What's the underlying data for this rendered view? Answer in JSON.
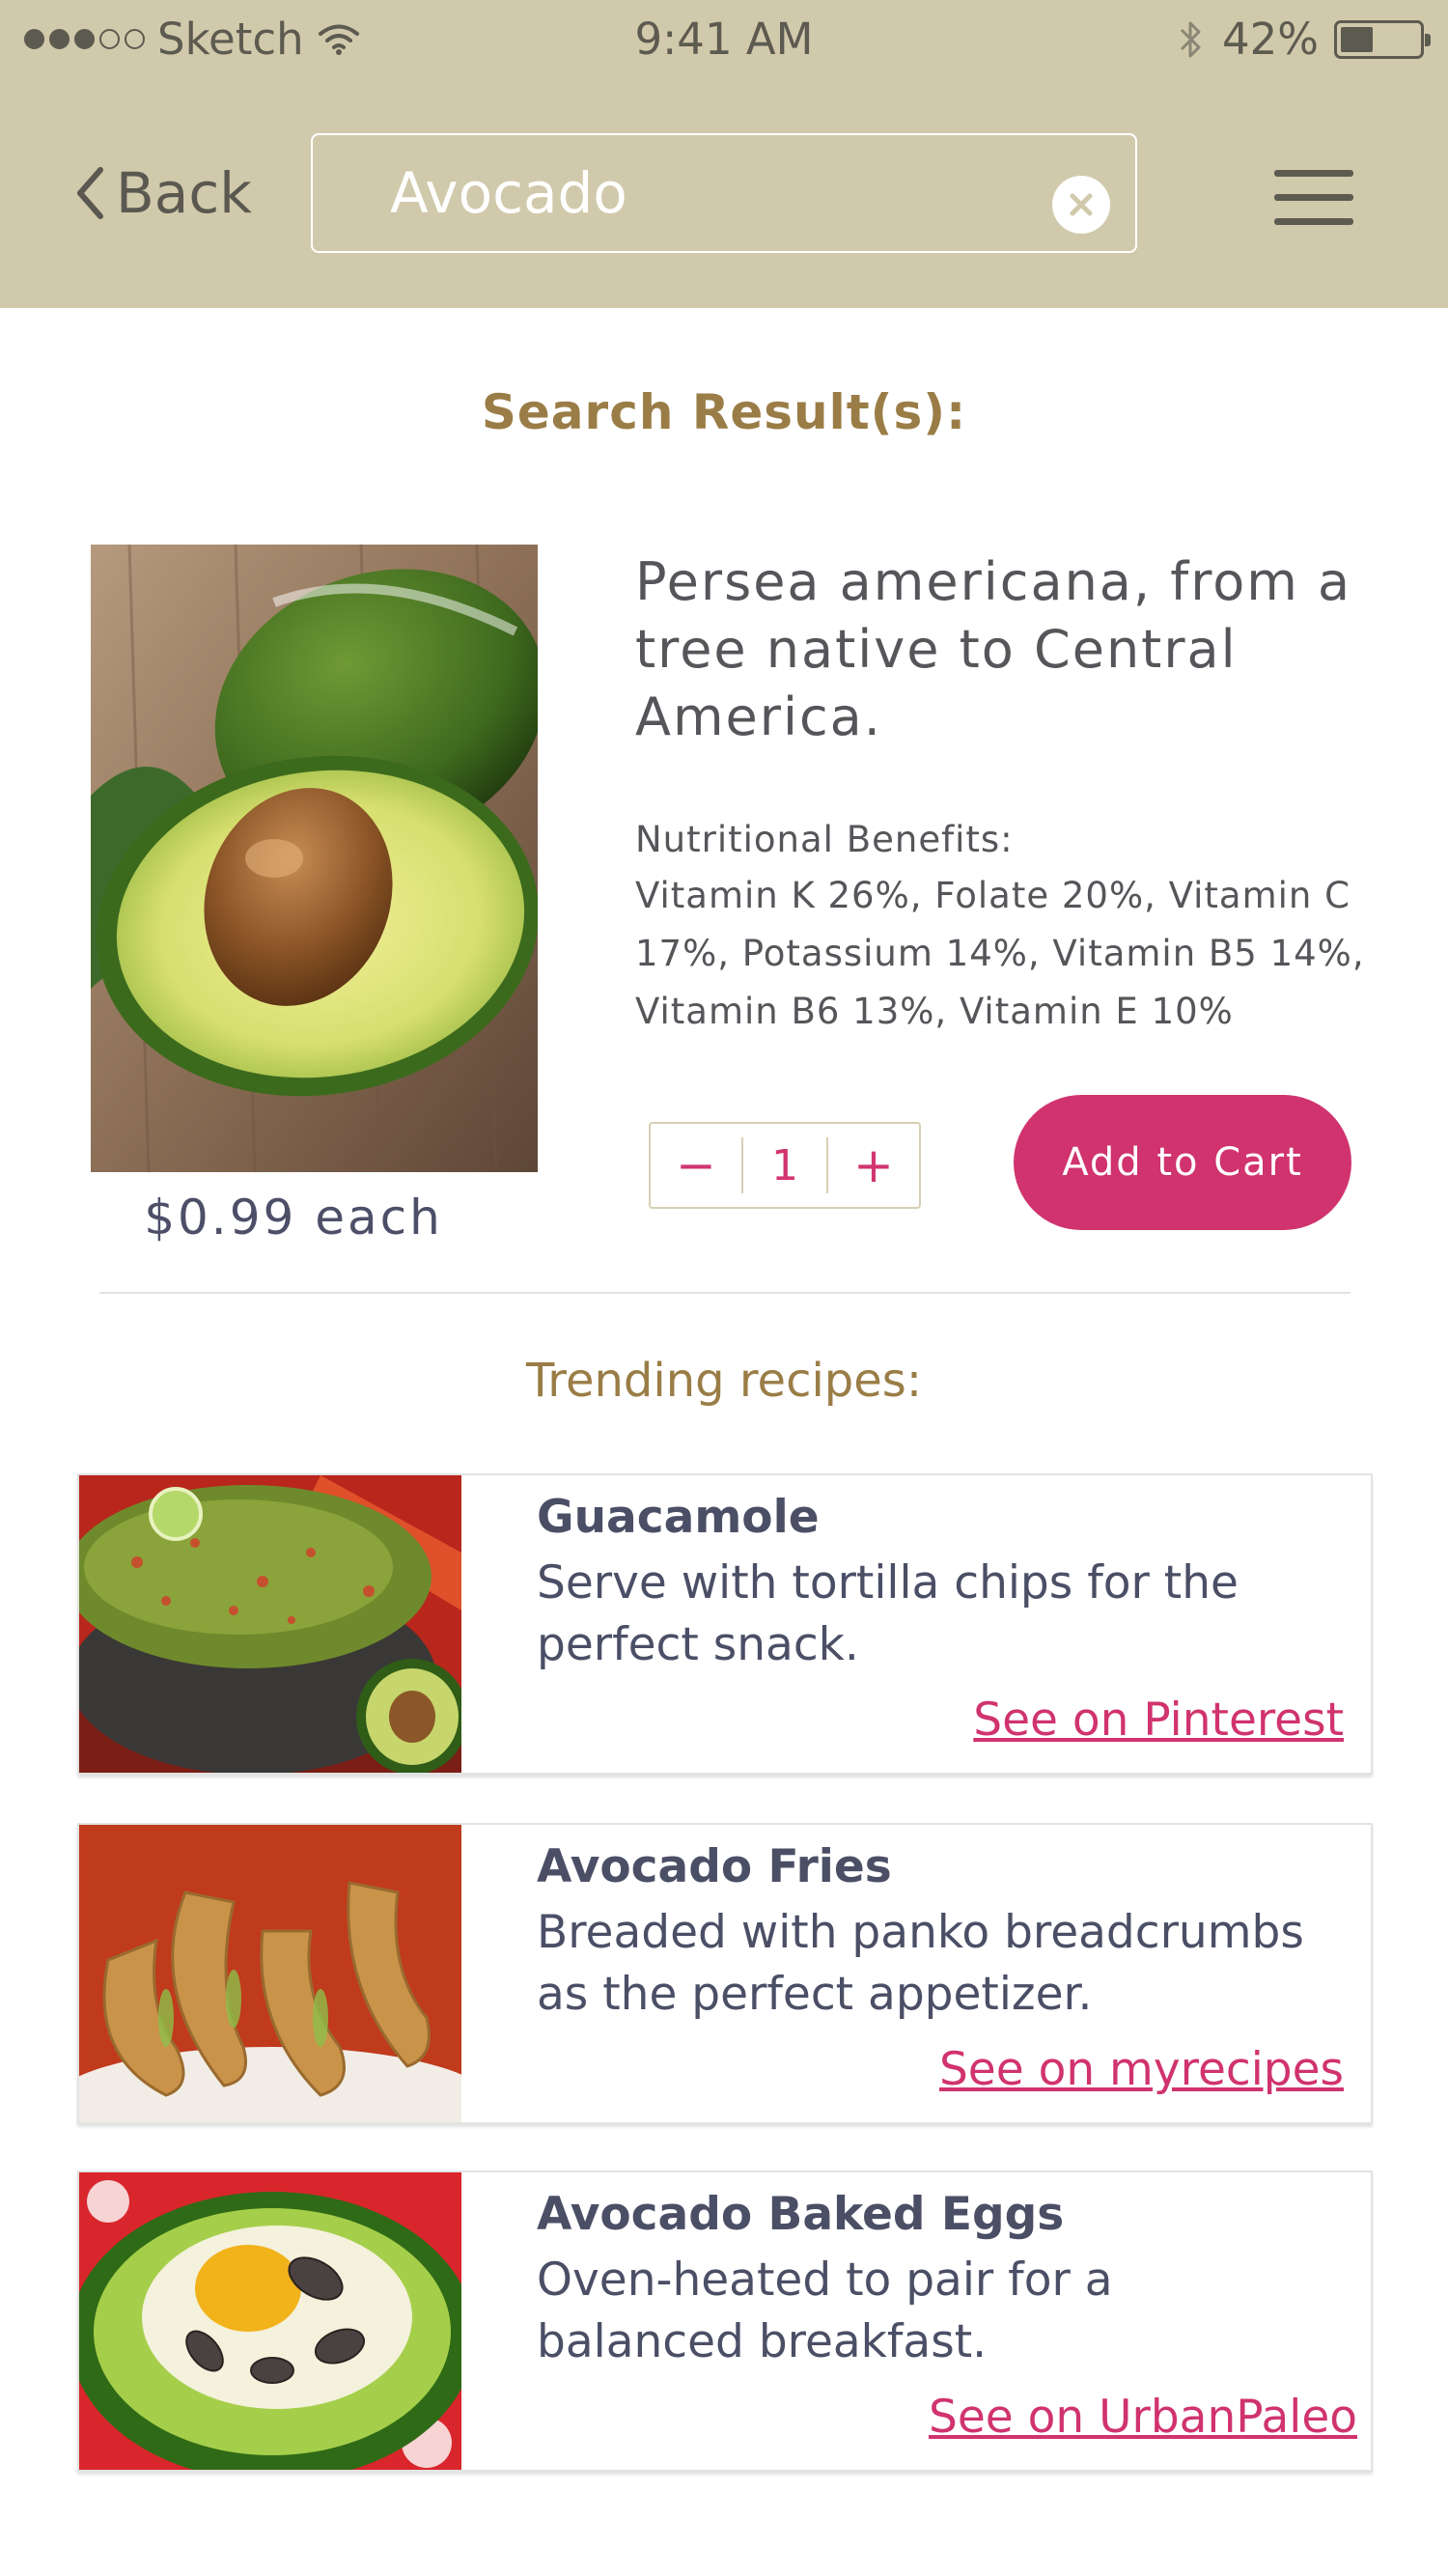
{
  "status_bar": {
    "carrier": "Sketch",
    "time": "9:41 AM",
    "battery": "42%",
    "battery_level": 0.42,
    "signal_bars_filled": 3,
    "signal_bars_total": 5,
    "icons": [
      "wifi-icon",
      "bluetooth-icon",
      "battery-icon"
    ]
  },
  "nav": {
    "back_label": "Back",
    "search_value": "Avocado",
    "icons": [
      "chevron-left-icon",
      "clear-icon",
      "hamburger-menu-icon"
    ]
  },
  "results_heading": "Search Result(s):",
  "product": {
    "description": "Persea americana, from a tree native to Central America.",
    "nutrition_title": "Nutritional Benefits:",
    "nutrition_text": "Vitamin K 26%, Folate 20%, Vitamin C 17%, Potassium 14%, Vitamin B5 14%, Vitamin B6 13%, Vitamin E 10%",
    "price": "$0.99 each",
    "quantity": "1",
    "minus_label": "−",
    "plus_label": "+",
    "add_to_cart_label": "Add to Cart"
  },
  "trending_heading": "Trending recipes:",
  "recipes": [
    {
      "title": "Guacamole",
      "description": "Serve with tortilla chips for the perfect snack.",
      "link": "See on Pinterest"
    },
    {
      "title": "Avocado Fries",
      "description": "Breaded with panko breadcrumbs as the perfect appetizer.",
      "link": "See on myrecipes"
    },
    {
      "title": "Avocado Baked Eggs",
      "description": "Oven-heated to pair for a balanced breakfast.",
      "link": "See on UrbanPaleo"
    }
  ],
  "colors": {
    "header_bg": "#d1c9ab",
    "accent_pink": "#d0336e",
    "heading_gold": "#9a7d46",
    "body_text": "#4b4f66"
  }
}
